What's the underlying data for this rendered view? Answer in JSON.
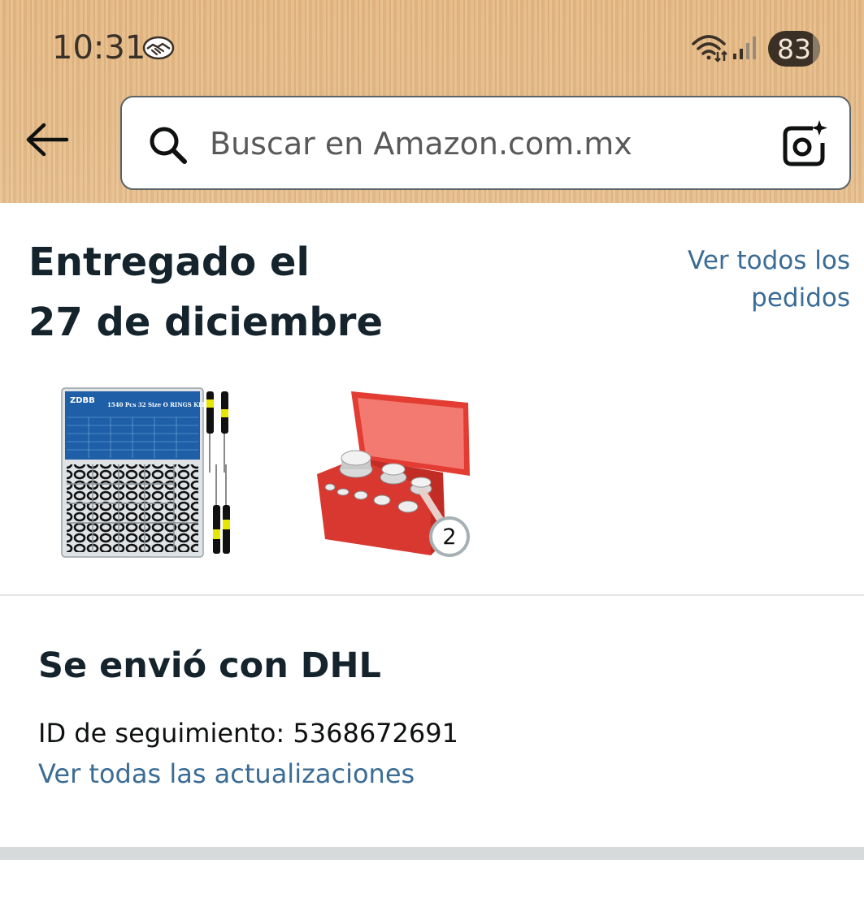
{
  "status_bar": {
    "time": "10:31",
    "battery": "83"
  },
  "search": {
    "placeholder": "Buscar en Amazon.com.mx"
  },
  "delivery": {
    "title_line1": "Entregado el",
    "title_line2": "27 de diciembre",
    "view_orders_line1": "Ver todos los",
    "view_orders_line2": "pedidos",
    "product_quantity_badge": "2",
    "product_1_box_brand": "ZDBB",
    "product_1_box_text": "1540 Pcs 32 Size O RINGS KIT"
  },
  "shipping": {
    "title": "Se envió con DHL",
    "tracking_id": "ID de seguimiento: 5368672691",
    "updates_link": "Ver todas las actualizaciones"
  },
  "colors": {
    "link": "#3b6c95",
    "heading": "#14232c",
    "header_bg": "#e7b983"
  }
}
